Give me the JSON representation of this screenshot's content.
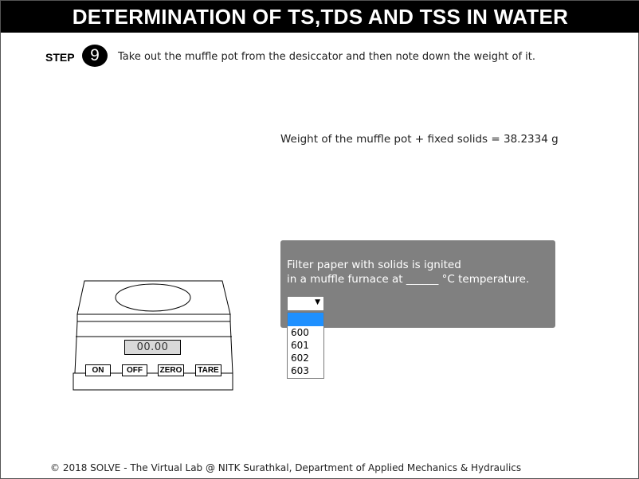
{
  "title": "DETERMINATION OF TS,TDS AND TSS IN WATER",
  "step": {
    "label": "STEP",
    "number": "9",
    "instruction": "Take out the muffle pot from the desiccator and then note down the weight of it."
  },
  "weight_text": "Weight of the muffle pot + fixed solids = 38.2334 g",
  "balance": {
    "display_value": "00.00",
    "buttons": {
      "on": "ON",
      "off": "OFF",
      "zero": "ZERO",
      "tare": "TARE"
    }
  },
  "question": {
    "line1": "Filter paper with solids is ignited",
    "line2": "in a muffle furnace at ______ °C temperature.",
    "selected_value": "",
    "options": [
      "",
      "600",
      "601",
      "602",
      "603"
    ],
    "highlight_color": "#1e90ff"
  },
  "footer": "© 2018 SOLVE - The Virtual Lab @ NITK Surathkal, Department of Applied Mechanics & Hydraulics"
}
